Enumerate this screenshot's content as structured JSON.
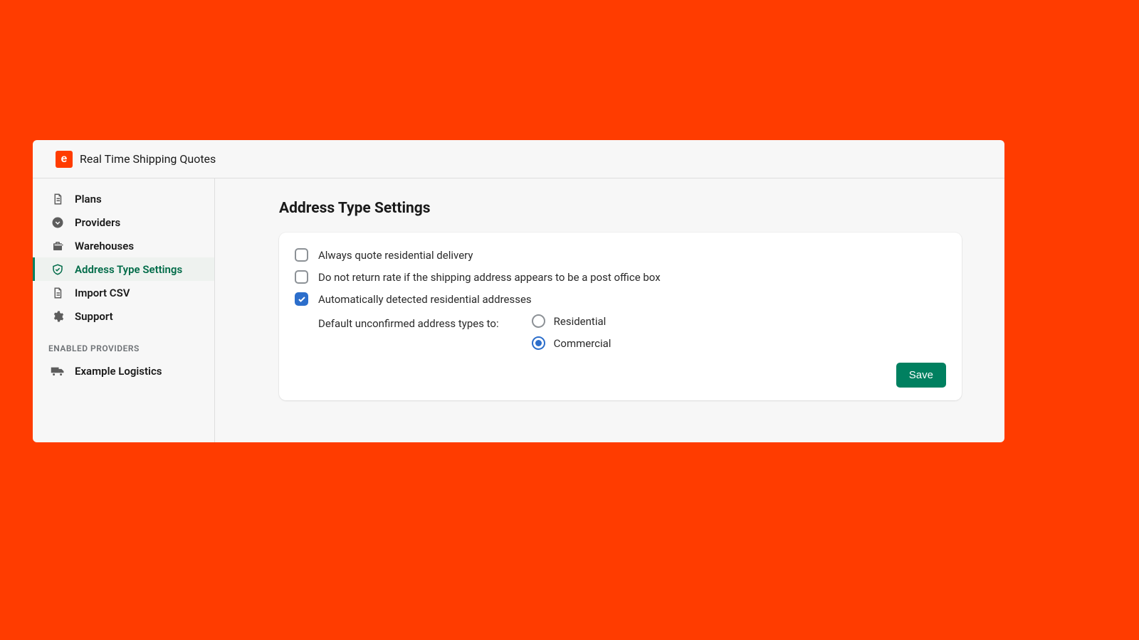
{
  "header": {
    "logo_letter": "e",
    "app_title": "Real Time Shipping Quotes"
  },
  "sidebar": {
    "items": [
      {
        "label": "Plans",
        "icon": "file-list-icon",
        "active": false
      },
      {
        "label": "Providers",
        "icon": "download-circle-icon",
        "active": false
      },
      {
        "label": "Warehouses",
        "icon": "briefcase-icon",
        "active": false
      },
      {
        "label": "Address Type Settings",
        "icon": "shield-check-icon",
        "active": true
      },
      {
        "label": "Import CSV",
        "icon": "file-icon",
        "active": false
      },
      {
        "label": "Support",
        "icon": "gear-icon",
        "active": false
      }
    ],
    "section_label": "ENABLED PROVIDERS",
    "providers": [
      {
        "label": "Example Logistics",
        "icon": "truck-icon"
      }
    ]
  },
  "main": {
    "title": "Address Type Settings",
    "checkboxes": [
      {
        "label": "Always quote residential delivery",
        "checked": false
      },
      {
        "label": "Do not return rate if the shipping address appears to be a post office box",
        "checked": false
      },
      {
        "label": "Automatically detected residential addresses",
        "checked": true
      }
    ],
    "default_label": "Default unconfirmed address types to:",
    "radios": [
      {
        "label": "Residential",
        "selected": false
      },
      {
        "label": "Commercial",
        "selected": true
      }
    ],
    "save_label": "Save"
  }
}
